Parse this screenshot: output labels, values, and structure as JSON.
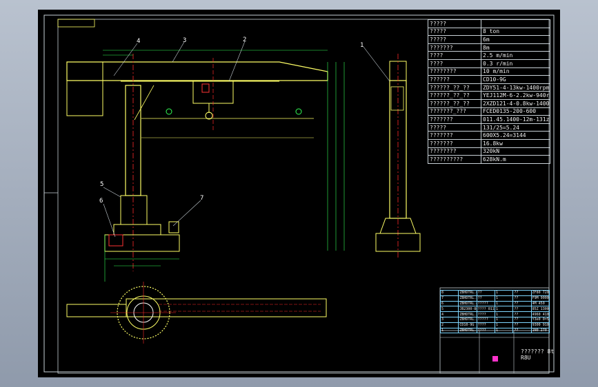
{
  "params": [
    {
      "key": "?????",
      "value": ""
    },
    {
      "key": "?????",
      "value": "8 ton"
    },
    {
      "key": "?????",
      "value": "6m"
    },
    {
      "key": "???????",
      "value": "8m"
    },
    {
      "key": "????",
      "value": "2.5 m/min"
    },
    {
      "key": "????",
      "value": "0.3 r/min"
    },
    {
      "key": "????????",
      "value": "10 m/min"
    },
    {
      "key": "??????",
      "value": "CD10-9G"
    },
    {
      "key": "??????_??_??",
      "value": "ZDY51-4-13kw-1400rpm"
    },
    {
      "key": "??????_??_??",
      "value": "YEJ112M-6-2.2kw-940rpm"
    },
    {
      "key": "??????_??_??",
      "value": "2XZD121-4-0.8kw-1400rpm"
    },
    {
      "key": "???????_???",
      "value": "FCED0135-200-600"
    },
    {
      "key": "???????",
      "value": "011.45.1400-12m-131z"
    },
    {
      "key": "?????",
      "value": "131/25=5.24"
    },
    {
      "key": "???????",
      "value": "600X5.24=3144"
    },
    {
      "key": "???????",
      "value": "16.8kw"
    },
    {
      "key": "????????",
      "value": "320kN"
    },
    {
      "key": "??????????",
      "value": "628kN.m"
    }
  ],
  "part_labels": [
    "1",
    "2",
    "3",
    "4",
    "5",
    "6",
    "7"
  ],
  "bom_rows": [
    [
      "8",
      "ZBHDTRL.6",
      "??",
      "1",
      "??",
      "ZF80 7200"
    ],
    [
      "7",
      "ZBHDTRL.5",
      "??",
      "1",
      "??",
      "F9M 9000"
    ],
    [
      "6",
      "ZBHDTRL.4",
      "?????",
      "1",
      "??",
      "4M 450"
    ],
    [
      "5",
      "JB2300-84",
      "???? 011.45.1400",
      "1",
      "??",
      "85Z 1300"
    ],
    [
      "4",
      "ZBHDTRL.3",
      "????",
      "1",
      "??",
      "4960 4100"
    ],
    [
      "3",
      "ZBHDTRL.2",
      "?????",
      "1",
      "??",
      "Y3e0 0=5"
    ],
    [
      "2",
      "CD10-9G",
      "????",
      "1",
      "??",
      "9300 9100"
    ],
    [
      "1",
      "ZBHDTRL.1",
      "????",
      "1",
      "??",
      "1N0 270"
    ]
  ],
  "title_block": {
    "title": "??????? 8t R8U"
  },
  "colors": {
    "frame": "#c9d2d8",
    "structure": "#ffff66",
    "dimension": "#33ff55",
    "centerline": "#ff2a2a",
    "bom_border": "#7fd7ff"
  }
}
